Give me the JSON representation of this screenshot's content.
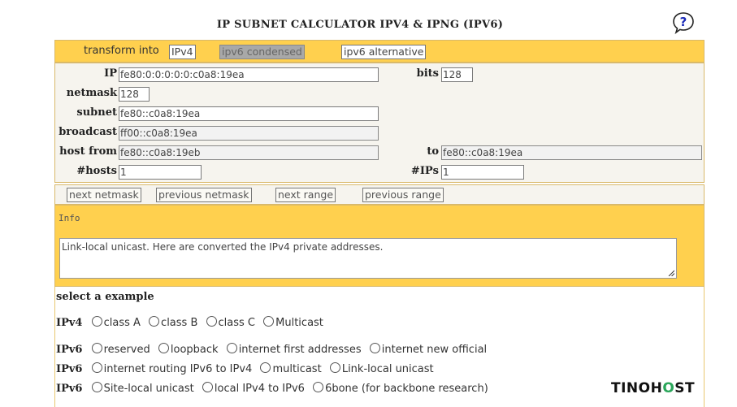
{
  "title": "IP SUBNET CALCULATOR IPV4 & IPNG (IPV6)",
  "help_icon": "question-bubble-icon",
  "transform": {
    "label": "transform into",
    "buttons": [
      "IPv4",
      "ipv6 condensed",
      "ipv6 alternative"
    ]
  },
  "fields": {
    "ip": {
      "label": "IP",
      "value": "fe80:0:0:0:0:0:c0a8:19ea"
    },
    "bits": {
      "label": "bits",
      "value": "128"
    },
    "netmask": {
      "label": "netmask",
      "value": "128"
    },
    "subnet": {
      "label": "subnet",
      "value": "fe80::c0a8:19ea"
    },
    "broadcast": {
      "label": "broadcast",
      "value": "ff00::c0a8:19ea"
    },
    "host_from": {
      "label": "host from",
      "value": "fe80::c0a8:19eb"
    },
    "to": {
      "label": "to",
      "value": "fe80::c0a8:19ea"
    },
    "hosts": {
      "label": "#hosts",
      "value": "1"
    },
    "ips": {
      "label": "#IPs",
      "value": "1"
    }
  },
  "nav_buttons": [
    "next netmask",
    "previous netmask",
    "next range",
    "previous range"
  ],
  "info": {
    "label": "Info",
    "text": "Link-local unicast. Here are converted the IPv4 private addresses."
  },
  "examples": {
    "heading": "select a example",
    "rows": [
      {
        "key": "IPv4",
        "options": [
          "class A",
          "class B",
          "class C",
          "Multicast"
        ]
      },
      {
        "key": "IPv6",
        "options": [
          "reserved",
          "loopback",
          "internet first addresses",
          "internet new official"
        ]
      },
      {
        "key": "IPv6",
        "options": [
          "internet routing IPv6 to IPv4",
          "multicast",
          "Link-local unicast"
        ]
      },
      {
        "key": "IPv6",
        "options": [
          "Site-local unicast",
          "local IPv4 to IPv6",
          "6bone (for backbone research)"
        ]
      }
    ]
  },
  "brand": {
    "part1": "TINO",
    "part2": "H",
    "part3": "O",
    "part4": "ST"
  },
  "colors": {
    "gold": "#ffd04e",
    "cream": "#f6f4ee",
    "brand_green": "#2aa65a"
  }
}
